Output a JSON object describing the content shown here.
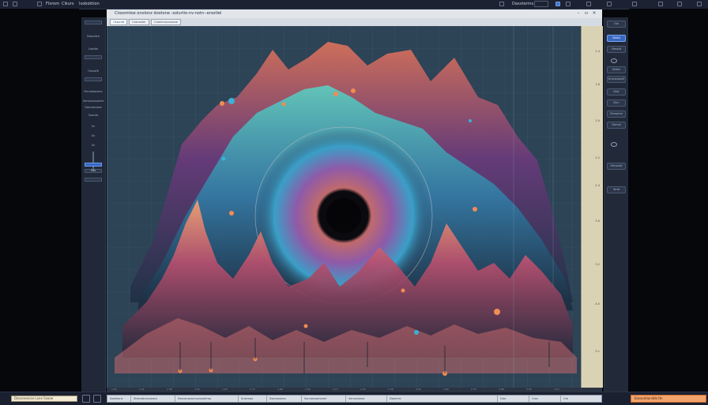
{
  "menu": {
    "items": [
      "Flxrom",
      "Cikurs",
      "Isoboktion"
    ],
    "right_label": "Daxxterins"
  },
  "document": {
    "title": "Ctsosmtoe onolonz dootone -solurtio-nv-notn--ersotlel",
    "tabs": [
      "Ossondt",
      "Cosnoster",
      "Cotomnsonsonse"
    ]
  },
  "left_tools": {
    "labels": [
      "Dassolve",
      "Lootbe",
      "Osmotlt",
      "Fennoloosme",
      "Semsonnsomls",
      "Gannsonose",
      "Osanto",
      "Sn",
      "Sn",
      "Sn"
    ],
    "field_value": "0do"
  },
  "right_tools": {
    "buttons": [
      "Oio",
      "Stntd",
      "Desstd",
      "Mstlsl",
      "Gneusiloct/l",
      "Stut",
      "Dun",
      "Dnosmol",
      "Slsmol",
      "Stmontd",
      "Smd"
    ]
  },
  "ruler": {
    "vertical": [
      "1.4",
      "1.6",
      "2.0",
      "2.2",
      "2.4",
      "3.0",
      "3.2",
      "4.0",
      "5.1"
    ],
    "horizontal": [
      "1.25",
      "1.31",
      "1.38",
      "1.50",
      "1.63",
      "1.75",
      "1.88",
      "2.00",
      "2.13",
      "2.25",
      "2.38",
      "2.50",
      "2.63",
      "2.75",
      "2.88",
      "3.00",
      "3.13"
    ]
  },
  "status": {
    "left_field": "Danoneonse Lone Ssooe",
    "segments": [
      "Sootlorns",
      "Stesnotnonseons",
      "Sesconsosorsonsaidmss",
      "Snstmoo",
      "Ssenosoons",
      "Sonnonsomoner",
      "Senonsmoe",
      "Doenms",
      "Clos",
      "Cros",
      "Cre"
    ],
    "right_field": "Eossontionidle Itn"
  },
  "colors": {
    "accent": "#3867c2",
    "canvas_bg": "#2d4356",
    "warm_peak": "#f0845a",
    "cool_peak": "#2fb5b5",
    "violet": "#7a3f86"
  }
}
